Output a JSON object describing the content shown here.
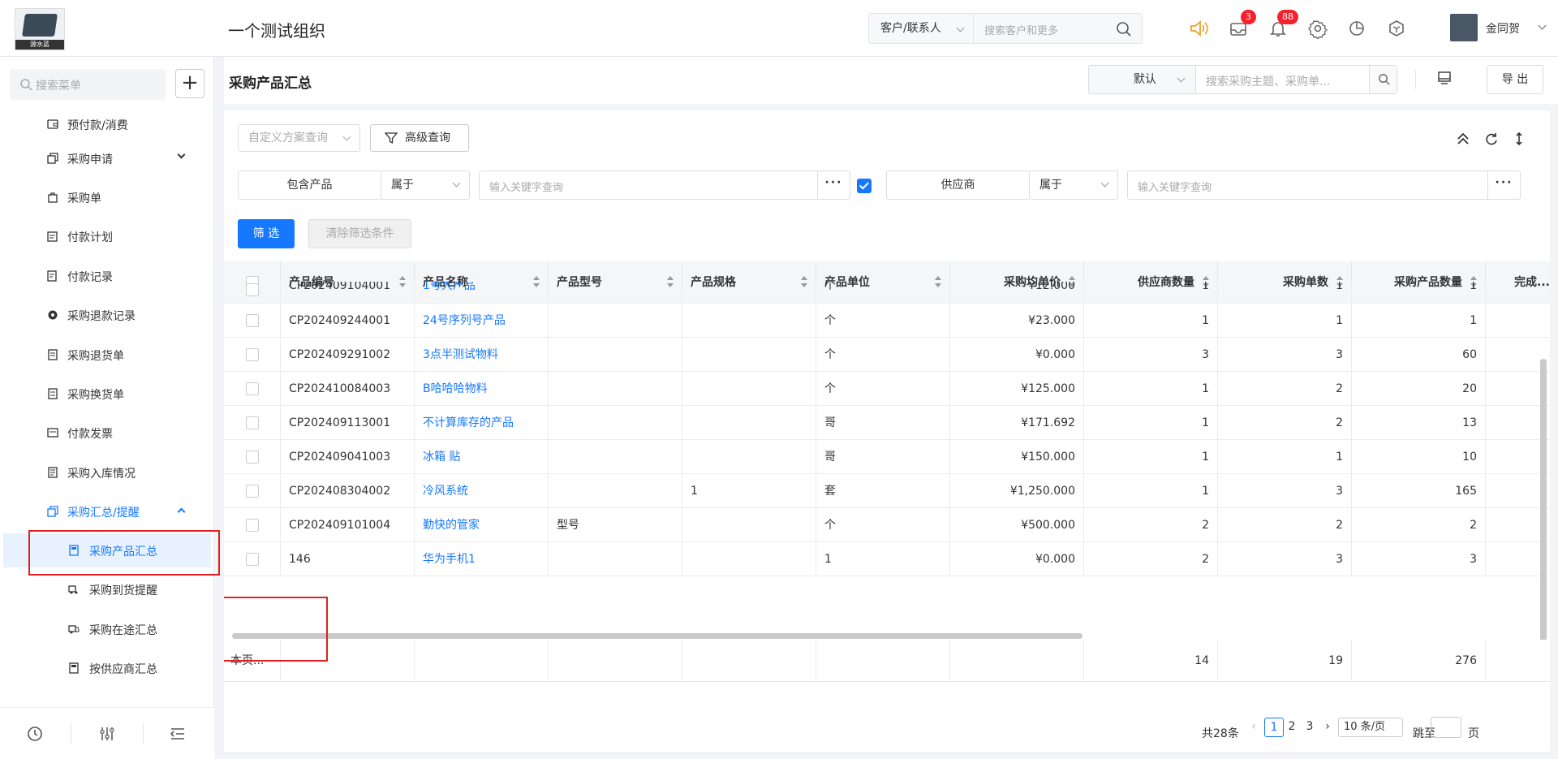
{
  "header": {
    "logo_caption": "源水蓝",
    "org_name": "一个测试组织",
    "search_scope": "客户/联系人",
    "search_placeholder": "搜索客户和更多",
    "msg_badge": "3",
    "notif_badge": "88",
    "user_name": "金同贺"
  },
  "sidebar": {
    "search_placeholder": "搜索菜单",
    "items": [
      {
        "label": "预付款/消费",
        "icon": "wallet-icon"
      },
      {
        "label": "采购申请",
        "icon": "copy-icon",
        "expand": "down"
      },
      {
        "label": "采购单",
        "icon": "bag-icon"
      },
      {
        "label": "付款计划",
        "icon": "calendar-icon"
      },
      {
        "label": "付款记录",
        "icon": "edit-icon"
      },
      {
        "label": "采购退款记录",
        "icon": "refund-icon"
      },
      {
        "label": "采购退货单",
        "icon": "doc-icon"
      },
      {
        "label": "采购换货单",
        "icon": "exchange-icon"
      },
      {
        "label": "付款发票",
        "icon": "invoice-icon"
      },
      {
        "label": "采购入库情况",
        "icon": "stock-icon"
      },
      {
        "label": "采购汇总/提醒",
        "icon": "copy-icon",
        "expand": "up"
      }
    ],
    "sub_items": [
      {
        "label": "采购产品汇总",
        "icon": "calculator-icon"
      },
      {
        "label": "采购到货提醒",
        "icon": "truck-icon"
      },
      {
        "label": "采购在途汇总",
        "icon": "truck-icon"
      },
      {
        "label": "按供应商汇总",
        "icon": "calculator-icon"
      }
    ]
  },
  "page": {
    "title": "采购产品汇总",
    "view_select": "默认",
    "search_placeholder": "搜索采购主题、采购单...",
    "export_label": "导 出"
  },
  "filters": {
    "scheme_placeholder": "自定义方案查询",
    "advanced_label": "高级查询",
    "f1_field": "包含产品",
    "f1_op": "属于",
    "f1_placeholder": "输入关键字查询",
    "f2_field": "供应商",
    "f2_op": "属于",
    "f2_placeholder": "输入关键字查询",
    "filter_button": "筛 选",
    "clear_button": "清除筛选条件"
  },
  "table": {
    "columns": [
      "产品编号",
      "产品名称",
      "产品型号",
      "产品规格",
      "产品单位",
      "采购均单价",
      "供应商数量",
      "采购单数",
      "采购产品数量",
      "完成..."
    ],
    "partial_row": {
      "code": "CP202409104001",
      "name": "1号大产品",
      "unit": "个",
      "price": "¥12.000",
      "suppliers": "1",
      "orders": "1",
      "qty": "1"
    },
    "rows": [
      {
        "code": "CP202409244001",
        "name": "24号序列号产品",
        "model": "",
        "spec": "",
        "unit": "个",
        "price": "¥23.000",
        "suppliers": "1",
        "orders": "1",
        "qty": "1"
      },
      {
        "code": "CP202409291002",
        "name": "3点半测试物料",
        "model": "",
        "spec": "",
        "unit": "个",
        "price": "¥0.000",
        "suppliers": "3",
        "orders": "3",
        "qty": "60"
      },
      {
        "code": "CP202410084003",
        "name": "B哈哈哈物料",
        "model": "",
        "spec": "",
        "unit": "个",
        "price": "¥125.000",
        "suppliers": "1",
        "orders": "2",
        "qty": "20"
      },
      {
        "code": "CP202409113001",
        "name": "不计算库存的产品",
        "model": "",
        "spec": "",
        "unit": "哥",
        "price": "¥171.692",
        "suppliers": "1",
        "orders": "2",
        "qty": "13"
      },
      {
        "code": "CP202409041003",
        "name": "冰箱 贴",
        "model": "",
        "spec": "",
        "unit": "哥",
        "price": "¥150.000",
        "suppliers": "1",
        "orders": "1",
        "qty": "10"
      },
      {
        "code": "CP202408304002",
        "name": "冷风系统",
        "model": "",
        "spec": "1",
        "unit": "套",
        "price": "¥1,250.000",
        "suppliers": "1",
        "orders": "3",
        "qty": "165"
      },
      {
        "code": "CP202409101004",
        "name": "勤快的管家",
        "model": "型号",
        "spec": "",
        "unit": "个",
        "price": "¥500.000",
        "suppliers": "2",
        "orders": "2",
        "qty": "2"
      },
      {
        "code": "146",
        "name": "华为手机1",
        "model": "",
        "spec": "",
        "unit": "1",
        "price": "¥0.000",
        "suppliers": "2",
        "orders": "3",
        "qty": "3"
      }
    ],
    "summary": {
      "label": "本页...",
      "suppliers": "14",
      "orders": "19",
      "qty": "276"
    }
  },
  "pagination": {
    "total": "共28条",
    "pages": [
      "1",
      "2",
      "3"
    ],
    "current": "1",
    "page_size": "10 条/页",
    "goto": "跳至",
    "page_suffix": "页"
  },
  "colors": {
    "accent": "#1677ff",
    "highlight": "#e02020"
  }
}
